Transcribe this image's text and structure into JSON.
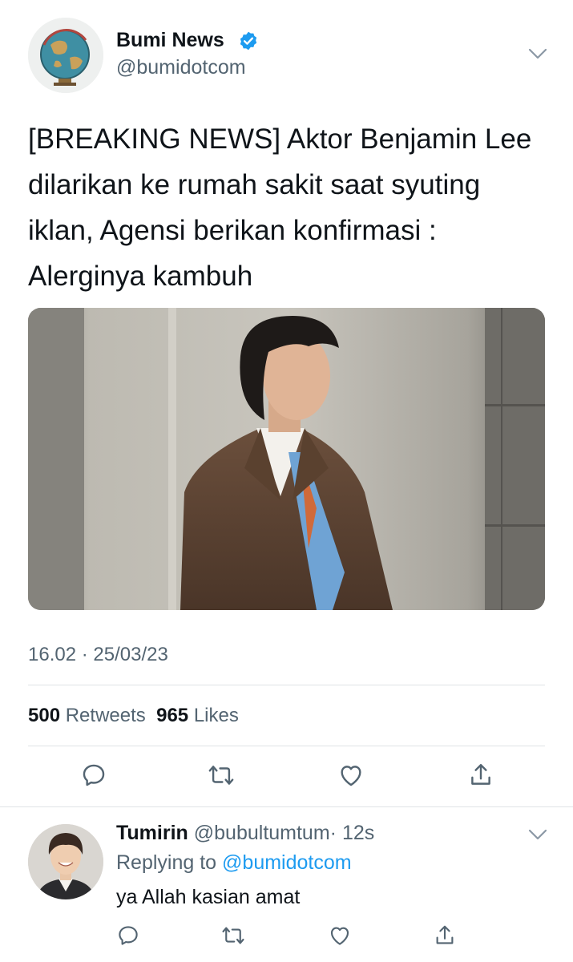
{
  "tweet": {
    "author": {
      "display_name": "Bumi News",
      "handle": "@bumidotcom",
      "verified": true,
      "avatar_icon": "globe-logo-icon"
    },
    "text": "[BREAKING NEWS] Aktor Benjamin Lee dilarikan ke rumah sakit saat syuting iklan, Agensi berikan konfirmasi : Alerginya kambuh",
    "media_description": "photo",
    "timestamp": "16.02 · 25/03/23",
    "stats": {
      "retweets_count": "500",
      "retweets_label": "Retweets",
      "likes_count": "965",
      "likes_label": "Likes"
    },
    "actions": [
      "reply-icon",
      "retweet-icon",
      "like-icon",
      "share-icon"
    ]
  },
  "reply": {
    "author": {
      "display_name": "Tumirin",
      "handle": "@bubultumtum",
      "time": "· 12s"
    },
    "replying_to_label": "Replying to",
    "replying_to_handle": "@bumidotcom",
    "text": "ya Allah kasian amat"
  },
  "colors": {
    "accent": "#1d9bf0",
    "secondary_text": "#536471",
    "primary_text": "#0f1419",
    "divider": "#dfe3e6"
  }
}
